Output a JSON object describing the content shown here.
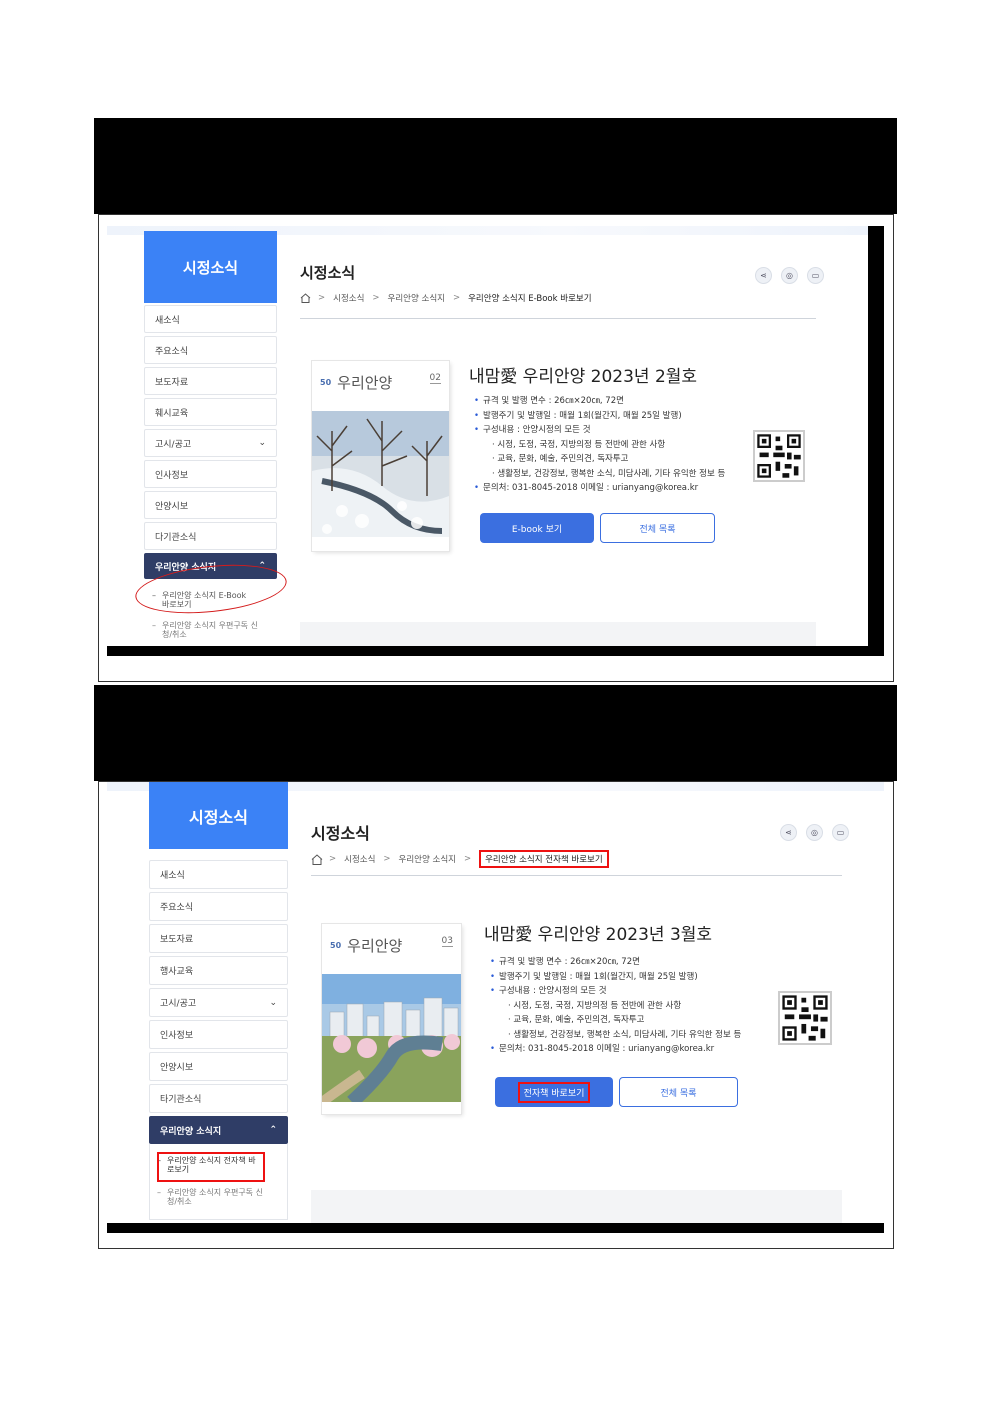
{
  "screen1": {
    "sidebar_title": "시정소식",
    "menu": [
      "새소식",
      "주요소식",
      "보도자료",
      "훼시교육",
      "고시/공고",
      "인사정보",
      "안양시보",
      "다기관소식"
    ],
    "menu_active": "우리안양 소식지",
    "submenu": [
      "우리안양 소식지 E-Book 바로보기",
      "우리안양 소식지 우편구독 신청/취소"
    ],
    "page_title": "시정소식",
    "breadcrumb": [
      "시정소식",
      "우리안양 소식지",
      "우리안양 소식지 E-Book 바로보기"
    ],
    "book_title": "내맘愛 우리안양 2023년 2월호",
    "cover": {
      "logo": "50",
      "mast": "우리안양",
      "issue": "02"
    },
    "info": [
      "규격 및 발행 면수 : 26㎝×20㎝, 72면",
      "발행주기 및 발행일 : 매월 1회(월간지, 매월 25일 발행)",
      "구성내용 : 안양시정의 모든 것",
      "시정, 도정, 국정, 지방의정 등 전반에 관한 사항",
      "교육, 문화, 예술, 주민의견, 독자투고",
      "생활정보, 건강정보, 행복한 소식, 미담사례, 기타 유익한 정보 등",
      "문의처: 031-8045-2018    이메일 : urianyang@korea.kr"
    ],
    "btn_primary": "E-book 보기",
    "btn_secondary": "전체 목록"
  },
  "screen2": {
    "sidebar_title": "시정소식",
    "menu": [
      "새소식",
      "주요소식",
      "보도자료",
      "행사교육",
      "고시/공고",
      "인사정보",
      "안양시보",
      "타기관소식"
    ],
    "menu_active": "우리안양 소식지",
    "submenu": [
      "우리안양 소식지 전자책 바로보기",
      "우리안양 소식지 우편구독 신청/취소"
    ],
    "page_title": "시정소식",
    "breadcrumb": [
      "시정소식",
      "우리안양 소식지",
      "우리안양 소식지 전자책 바로보기"
    ],
    "book_title": "내맘愛 우리안양 2023년 3월호",
    "cover": {
      "logo": "50",
      "mast": "우리안양",
      "issue": "03"
    },
    "info": [
      "규격 및 발행 면수 : 26㎝×20㎝, 72면",
      "발행주기 및 발행일 : 매월 1회(월간지, 매월 25일 발행)",
      "구성내용 : 안양시정의 모든 것",
      "시정, 도정, 국정, 지방의정 등 전반에 관한 사항",
      "교육, 문화, 예술, 주민의견, 독자투고",
      "생활정보, 건강정보, 행복한 소식, 미담사례, 기타 유익한 정보 등",
      "문의처: 031-8045-2018    이메일 : urianyang@korea.kr"
    ],
    "btn_primary": "전자책 바로보기",
    "btn_secondary": "전체 목록"
  },
  "colors": {
    "accent": "#3b82f6",
    "active_menu": "#2f3d66",
    "annotation": "#e11111",
    "button": "#3b6fe0"
  },
  "icons": [
    "home-icon",
    "share-icon",
    "pin-icon",
    "print-icon",
    "chevron-down-icon",
    "chevron-up-icon",
    "qr-code"
  ]
}
